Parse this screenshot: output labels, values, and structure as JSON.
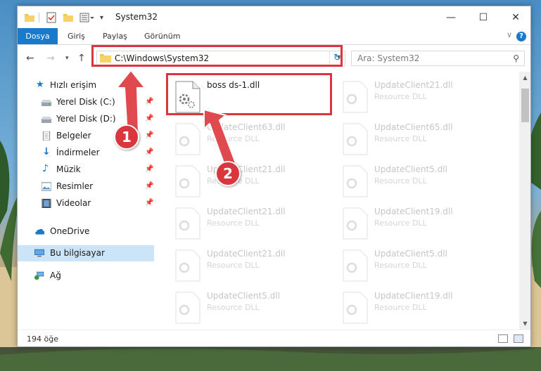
{
  "window": {
    "title": "System32",
    "controls": {
      "minimize": "—",
      "maximize": "☐",
      "close": "✕"
    }
  },
  "ribbon": {
    "tabs": [
      "Dosya",
      "Giriş",
      "Paylaş",
      "Görünüm"
    ],
    "help": "?",
    "collapse": "∨"
  },
  "address": {
    "path": "C:\\Windows\\System32",
    "search_placeholder": "Ara: System32"
  },
  "nav": {
    "items": [
      {
        "label": "Hızlı erişim",
        "icon": "star-icon"
      },
      {
        "label": "Yerel Disk (C:)",
        "icon": "drive-icon"
      },
      {
        "label": "Yerel Disk (D:)",
        "icon": "drive-icon"
      },
      {
        "label": "Belgeler",
        "icon": "documents-icon"
      },
      {
        "label": "İndirmeler",
        "icon": "download-icon"
      },
      {
        "label": "Müzik",
        "icon": "music-icon"
      },
      {
        "label": "Resimler",
        "icon": "pictures-icon"
      },
      {
        "label": "Videolar",
        "icon": "videos-icon"
      },
      {
        "label": "OneDrive",
        "icon": "cloud-icon"
      },
      {
        "label": "Bu bilgisayar",
        "icon": "computer-icon"
      },
      {
        "label": "Ağ",
        "icon": "network-icon"
      }
    ]
  },
  "files": [
    {
      "name": "boss ds-1.dll",
      "type": ""
    },
    {
      "name": "UpdateClient21.dll",
      "type": "Resource DLL"
    },
    {
      "name": "UpdateClient63.dll",
      "type": "Resource DLL"
    },
    {
      "name": "UpdateClient65.dll",
      "type": "Resource DLL"
    },
    {
      "name": "UpdateClient21.dll",
      "type": "Resource DLL"
    },
    {
      "name": "UpdateClient5.dll",
      "type": "Resource DLL"
    },
    {
      "name": "UpdateClient21.dll",
      "type": "Resource DLL"
    },
    {
      "name": "UpdateClient19.dll",
      "type": "Resource DLL"
    },
    {
      "name": "UpdateClient21.dll",
      "type": "Resource DLL"
    },
    {
      "name": "UpdateClient5.dll",
      "type": "Resource DLL"
    },
    {
      "name": "UpdateClient5.dll",
      "type": "Resource DLL"
    },
    {
      "name": "UpdateClient19.dll",
      "type": "Resource DLL"
    }
  ],
  "status": {
    "count": "194 öğe"
  },
  "annotations": {
    "badge1": "1",
    "badge2": "2",
    "color": "#d9363e"
  },
  "colors": {
    "accent": "#1979ca",
    "selection": "#cce4f7",
    "annotation": "#d9363e"
  }
}
